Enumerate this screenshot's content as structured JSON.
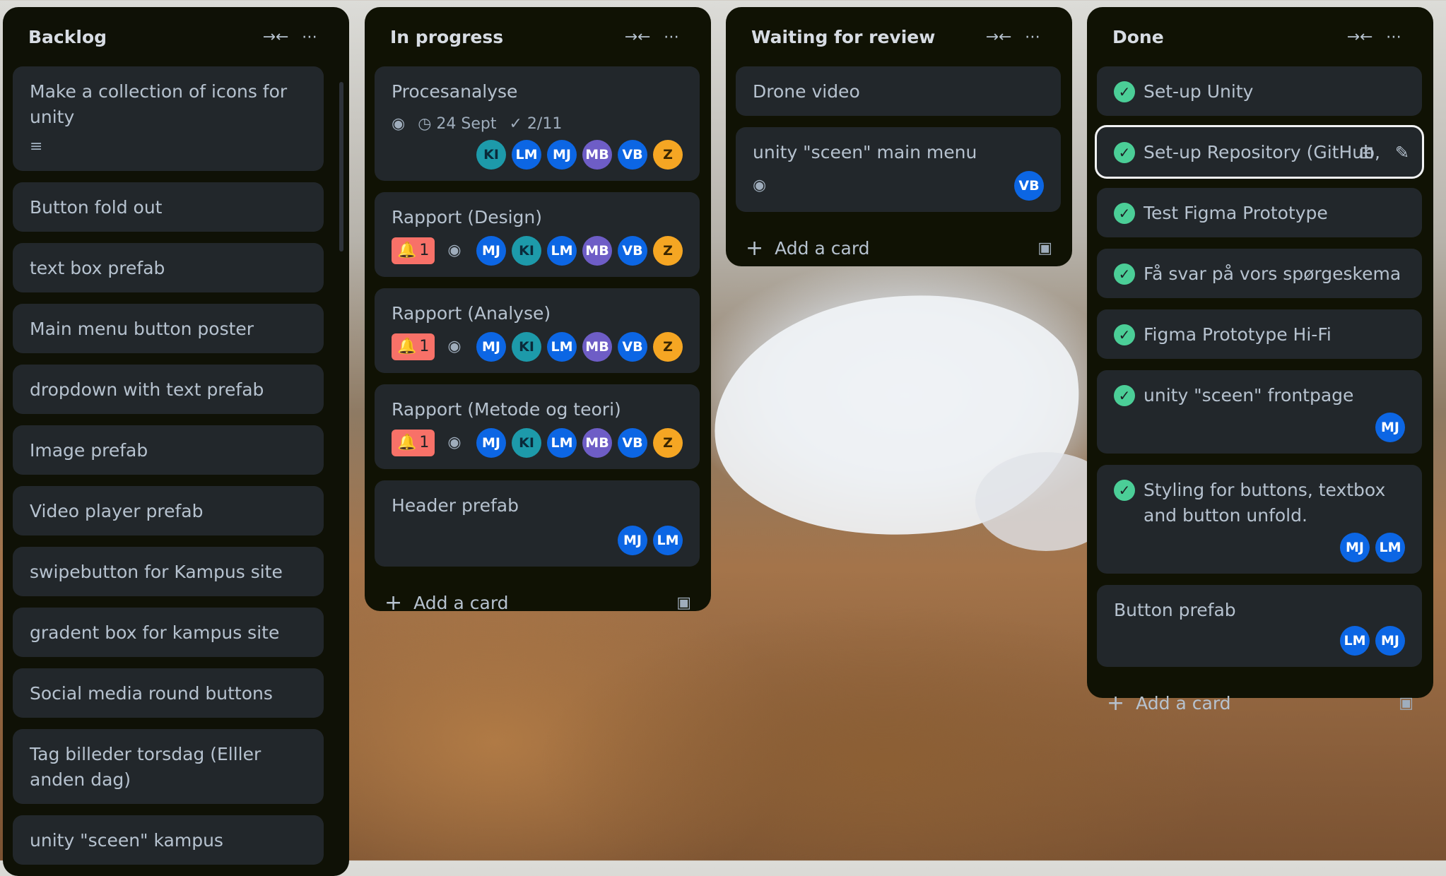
{
  "board": {
    "columns": [
      {
        "title": "Backlog",
        "cards": [
          {
            "title": "Make a collection of icons for unity"
          },
          {
            "title": "Button fold out"
          },
          {
            "title": "text box prefab"
          },
          {
            "title": "Main menu button poster"
          },
          {
            "title": "dropdown with text prefab"
          },
          {
            "title": "Image prefab"
          },
          {
            "title": "Video player prefab"
          },
          {
            "title": "swipebutton for Kampus site"
          },
          {
            "title": "gradent box for kampus site"
          },
          {
            "title": "Social media round buttons"
          },
          {
            "title": "Tag billeder torsdag (Elller anden dag)"
          },
          {
            "title": "unity \"sceen\" kampus"
          }
        ],
        "add_label": "Add a card"
      },
      {
        "title": "In progress",
        "cards": [
          {
            "title": "Procesanalyse",
            "date": "24 Sept",
            "checklist": "2/11"
          },
          {
            "title": "Rapport (Design)",
            "notifications": "1"
          },
          {
            "title": "Rapport (Analyse)",
            "notifications": "1"
          },
          {
            "title": "Rapport (Metode og teori)",
            "notifications": "1"
          },
          {
            "title": "Header prefab"
          }
        ],
        "add_label": "Add a card"
      },
      {
        "title": "Waiting for review",
        "cards": [
          {
            "title": "Drone video"
          },
          {
            "title": "unity \"sceen\" main menu"
          }
        ],
        "add_label": "Add a card"
      },
      {
        "title": "Done",
        "cards": [
          {
            "title": "Set-up Unity"
          },
          {
            "title": "Set-up Repository (GitHub,"
          },
          {
            "title": "Test Figma Prototype"
          },
          {
            "title": "Få svar på vors spørgeskema"
          },
          {
            "title": "Figma Prototype Hi-Fi"
          },
          {
            "title": "unity \"sceen\" frontpage"
          },
          {
            "title": "Styling for buttons, textbox and button unfold."
          },
          {
            "title": "Button prefab"
          }
        ],
        "add_label": "Add a card"
      }
    ]
  },
  "members": {
    "KI": "KI",
    "LM": "LM",
    "MJ": "MJ",
    "MB": "MB",
    "VB": "VB",
    "Z": "Z"
  },
  "glyphs": {
    "collapse": "→←",
    "more": "⋯",
    "plus": "+",
    "eye": "◉",
    "clock": "◷",
    "check": "✓",
    "bell": "🔔",
    "template": "▣",
    "lines": "≡",
    "archive": "⊟",
    "edit": "✎"
  },
  "colors": {
    "column_bg": "#101204",
    "card_bg": "#22272b",
    "text": "#b6c2cf",
    "done_check": "#4bce97",
    "bell_badge": "#f87168",
    "avatar_blue": "#0c66e4"
  }
}
